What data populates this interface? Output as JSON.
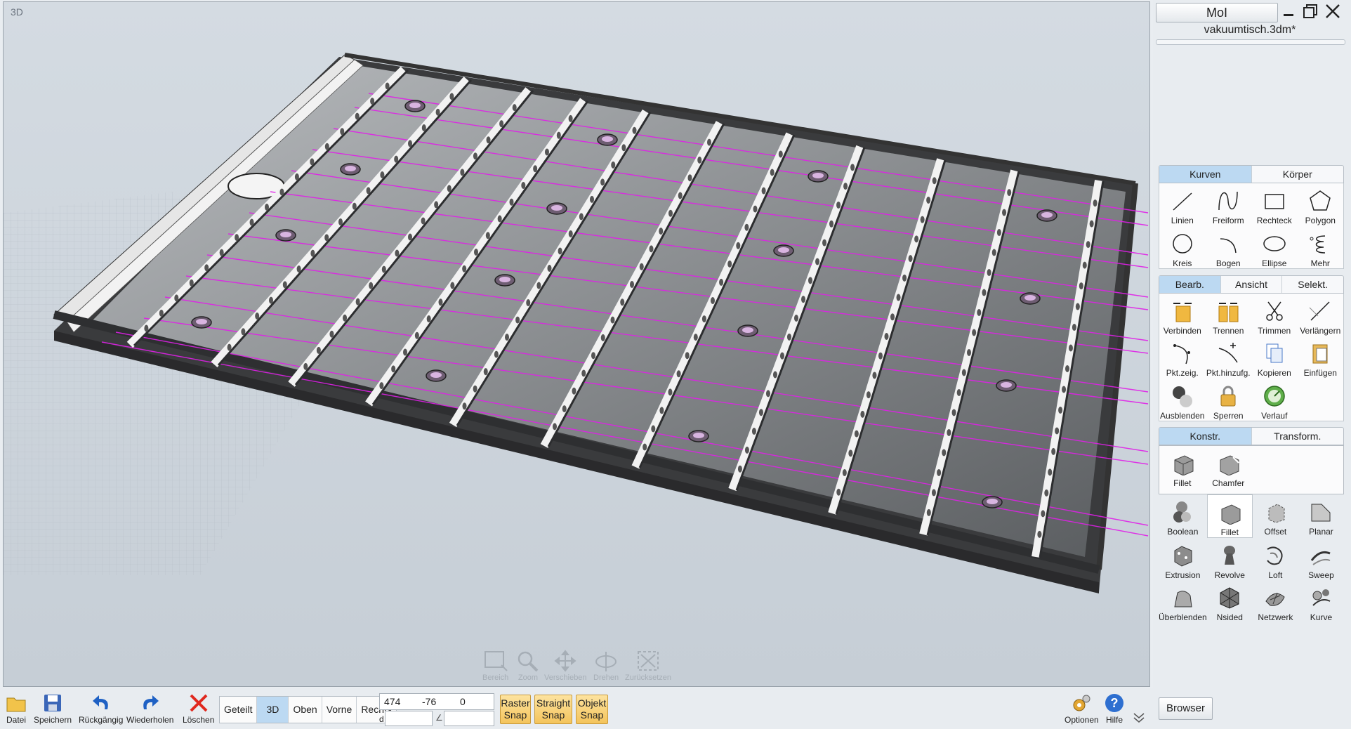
{
  "viewport": {
    "label": "3D"
  },
  "view_nav": [
    "Bereich",
    "Zoom",
    "Verschieben",
    "Drehen",
    "Zurücksetzen"
  ],
  "panel": {
    "app_title": "MoI",
    "file_name": "vakuumtisch.3dm*",
    "curves_tabs": [
      "Kurven",
      "Körper"
    ],
    "curves_tools": [
      "Linien",
      "Freiform",
      "Rechteck",
      "Polygon",
      "Kreis",
      "Bogen",
      "Ellipse",
      "Mehr"
    ],
    "edit_tabs": [
      "Bearb.",
      "Ansicht",
      "Selekt."
    ],
    "edit_tools": [
      "Verbinden",
      "Trennen",
      "Trimmen",
      "Verlängern",
      "Pkt.zeig.",
      "Pkt.hinzufg.",
      "Kopieren",
      "Einfügen",
      "Ausblenden",
      "Sperren",
      "Verlauf"
    ],
    "construct_tabs": [
      "Konstr.",
      "Transform."
    ],
    "fillet_flyout": [
      "Fillet",
      "Chamfer"
    ],
    "construct_tools": [
      "Boolean",
      "Fillet",
      "Offset",
      "Planar",
      "Extrusion",
      "Revolve",
      "Loft",
      "Sweep",
      "Überblenden",
      "Nsided",
      "Netzwerk",
      "Kurve"
    ]
  },
  "toolbar": {
    "file": "Datei",
    "save": "Speichern",
    "undo": "Rückgängig",
    "redo": "Wiederholen",
    "delete": "Löschen",
    "views": [
      "Geteilt",
      "3D",
      "Oben",
      "Vorne",
      "Rechts"
    ],
    "active_view": "3D",
    "coords": [
      "474",
      "-76",
      "0"
    ],
    "d_label": "d",
    "snaps": [
      [
        "Raster",
        "Snap"
      ],
      [
        "Straight",
        "Snap"
      ],
      [
        "Objekt",
        "Snap"
      ]
    ],
    "options": "Optionen",
    "help": "Hilfe",
    "browser": "Browser"
  },
  "colors": {
    "accent_tab": "#bcd9f2",
    "snap": "#f4c45c",
    "guide_lines": "#e020e8"
  }
}
